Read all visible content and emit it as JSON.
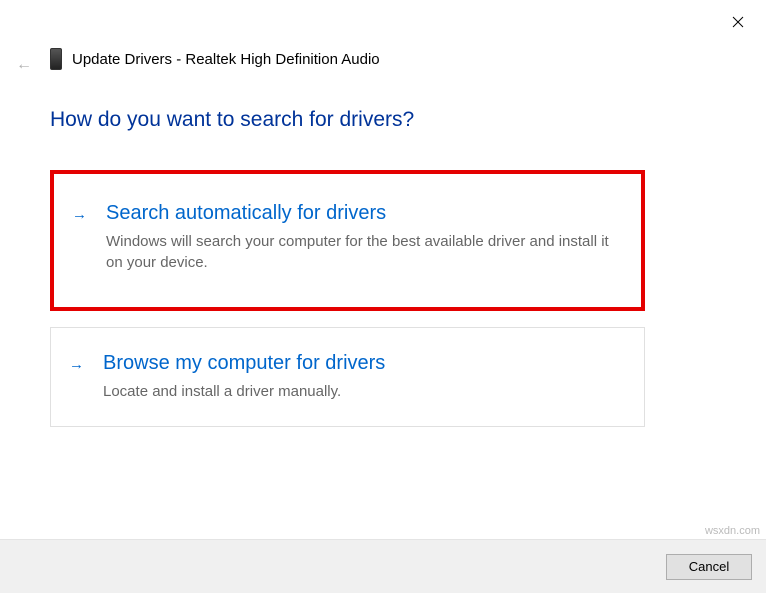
{
  "header": {
    "title": "Update Drivers - Realtek High Definition Audio"
  },
  "question": "How do you want to search for drivers?",
  "options": [
    {
      "title": "Search automatically for drivers",
      "desc": "Windows will search your computer for the best available driver and install it on your device."
    },
    {
      "title": "Browse my computer for drivers",
      "desc": "Locate and install a driver manually."
    }
  ],
  "footer": {
    "cancel": "Cancel"
  },
  "watermark": "wsxdn.com"
}
